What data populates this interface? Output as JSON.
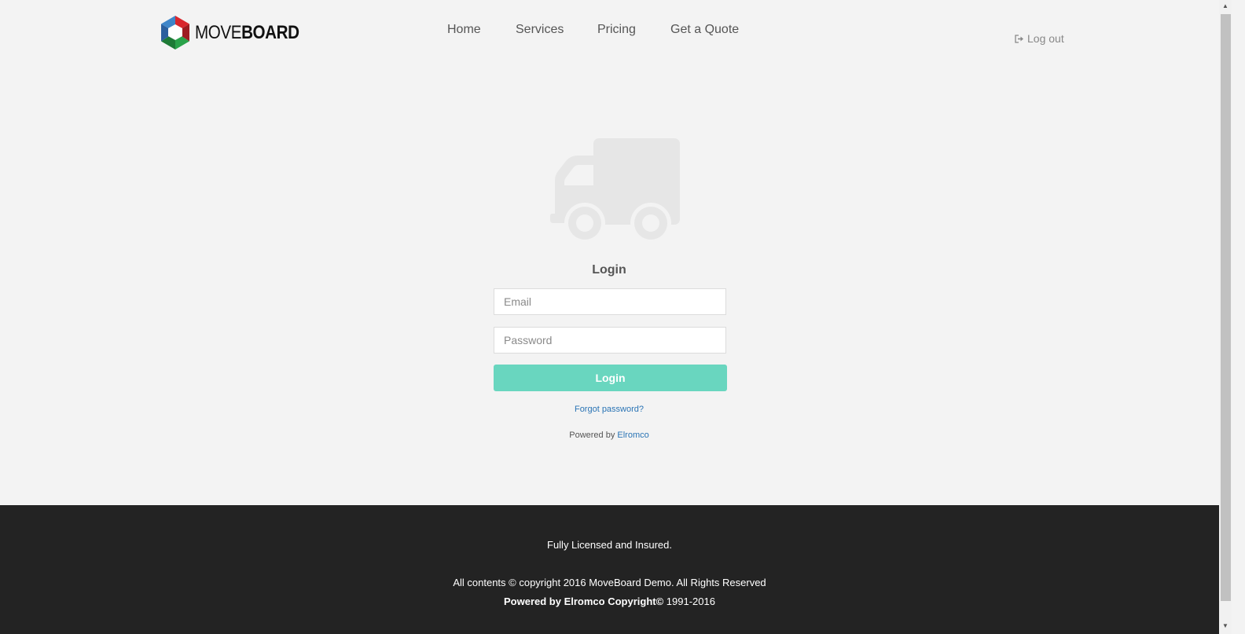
{
  "brand": {
    "name_part1": "MOVE",
    "name_part2": "BOARD"
  },
  "nav": {
    "items": [
      "Home",
      "Services",
      "Pricing",
      "Get a Quote"
    ]
  },
  "header": {
    "logout_label": "Log out"
  },
  "login": {
    "title": "Login",
    "email_placeholder": "Email",
    "email_value": "",
    "password_placeholder": "Password",
    "password_value": "",
    "button_label": "Login",
    "forgot_label": "Forgot password?",
    "powered_prefix": "Powered by",
    "powered_link": "Elromco"
  },
  "footer": {
    "line1": "Fully Licensed and Insured.",
    "line2": "All contents © copyright 2016 MoveBoard Demo. All Rights Reserved",
    "line3_bold": "Powered by Elromco Copyright©",
    "line3_rest": " 1991-2016"
  },
  "icons": [
    "logo-icon",
    "truck-icon",
    "logout-icon"
  ],
  "colors": {
    "accent": "#69d6bf",
    "link": "#2a74b5",
    "footer_bg": "#232323",
    "page_bg": "#f3f3f3"
  }
}
